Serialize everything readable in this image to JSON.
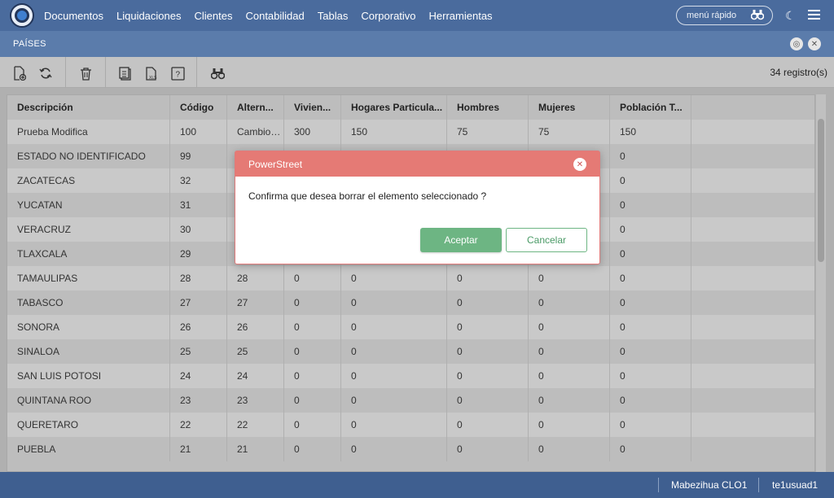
{
  "menu": [
    "Documentos",
    "Liquidaciones",
    "Clientes",
    "Contabilidad",
    "Tablas",
    "Corporativo",
    "Herramientas"
  ],
  "quick_menu": "menú rápido",
  "window_title": "PAÍSES",
  "record_count": "34 registro(s)",
  "columns": [
    "Descripción",
    "Código",
    "Altern...",
    "Vivien...",
    "Hogares Particula...",
    "Hombres",
    "Mujeres",
    "Población T..."
  ],
  "rows": [
    [
      "Prueba Modifica",
      "100",
      "Cambioalt:",
      "300",
      "150",
      "75",
      "75",
      "150"
    ],
    [
      "ESTADO NO IDENTIFICADO",
      "99",
      "",
      "",
      "",
      "",
      "",
      "0"
    ],
    [
      "ZACATECAS",
      "32",
      "",
      "",
      "",
      "",
      "",
      "0"
    ],
    [
      "YUCATAN",
      "31",
      "",
      "",
      "",
      "",
      "",
      "0"
    ],
    [
      "VERACRUZ",
      "30",
      "",
      "",
      "",
      "",
      "",
      "0"
    ],
    [
      "TLAXCALA",
      "29",
      "",
      "",
      "",
      "",
      "",
      "0"
    ],
    [
      "TAMAULIPAS",
      "28",
      "28",
      "0",
      "0",
      "0",
      "0",
      "0"
    ],
    [
      "TABASCO",
      "27",
      "27",
      "0",
      "0",
      "0",
      "0",
      "0"
    ],
    [
      "SONORA",
      "26",
      "26",
      "0",
      "0",
      "0",
      "0",
      "0"
    ],
    [
      "SINALOA",
      "25",
      "25",
      "0",
      "0",
      "0",
      "0",
      "0"
    ],
    [
      "SAN LUIS POTOSI",
      "24",
      "24",
      "0",
      "0",
      "0",
      "0",
      "0"
    ],
    [
      "QUINTANA ROO",
      "23",
      "23",
      "0",
      "0",
      "0",
      "0",
      "0"
    ],
    [
      "QUERETARO",
      "22",
      "22",
      "0",
      "0",
      "0",
      "0",
      "0"
    ],
    [
      "PUEBLA",
      "21",
      "21",
      "0",
      "0",
      "0",
      "0",
      "0"
    ]
  ],
  "status": {
    "company": "Mabezihua CLO1",
    "user": "te1usuad1"
  },
  "dialog": {
    "title": "PowerStreet",
    "message": "Confirma que desea borrar el elemento seleccionado ?",
    "ok": "Aceptar",
    "cancel": "Cancelar"
  }
}
